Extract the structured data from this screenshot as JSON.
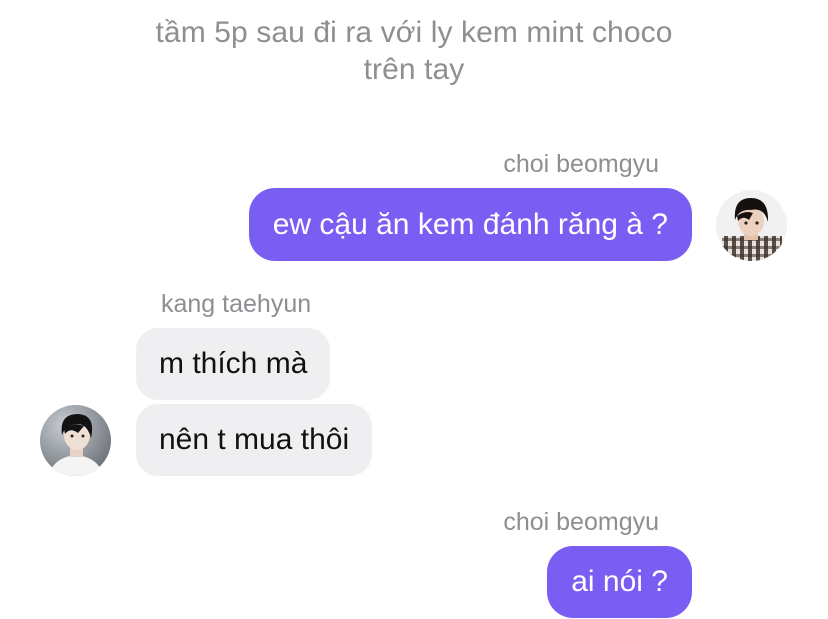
{
  "narration": {
    "line1": "tầm 5p sau đi ra với ly kem mint choco",
    "line2": "trên tay"
  },
  "messages": [
    {
      "sender": "choi beomgyu",
      "text": "ew cậu ăn kem đánh răng à ?"
    },
    {
      "sender": "kang taehyun",
      "text": "m thích mà"
    },
    {
      "text": "nên t mua thôi"
    },
    {
      "sender": "choi beomgyu",
      "text": "ai nói ?"
    }
  ],
  "colors": {
    "outgoing_bubble": "#7a5ef4",
    "incoming_bubble": "#efeff1",
    "meta_text": "#8e8e93"
  }
}
